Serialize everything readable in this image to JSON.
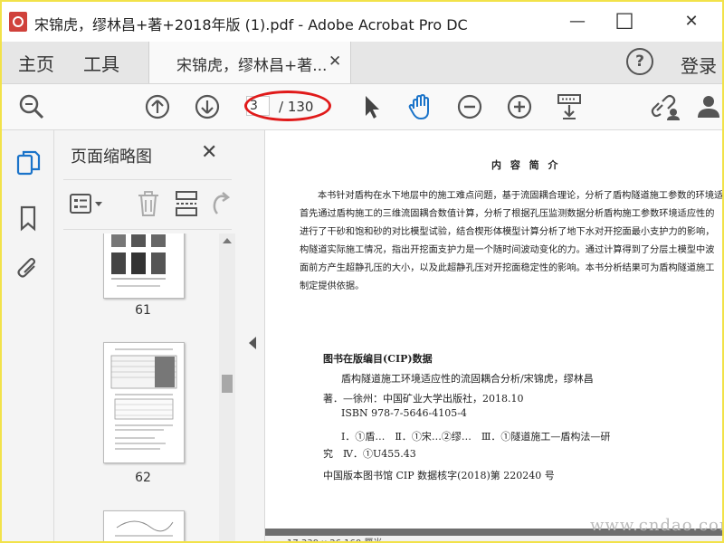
{
  "window": {
    "title": "宋锦虎，缪林昌+著+2018年版 (1).pdf - Adobe Acrobat Pro DC",
    "minimize": "—",
    "maximize": "☐",
    "close": "✕"
  },
  "tabs": {
    "home": "主页",
    "tools": "工具",
    "document": "宋锦虎，缪林昌+著...",
    "document_close": "✕",
    "help": "?",
    "login": "登录"
  },
  "toolbar": {
    "current_page": "3",
    "total_pages": "/ 130"
  },
  "thumbnail_panel": {
    "title": "页面缩略图",
    "close": "✕",
    "thumbnails": [
      {
        "label": "61"
      },
      {
        "label": "62"
      }
    ]
  },
  "document": {
    "heading": "内 容 简 介",
    "abstract_lines": [
      "本书针对盾构在水下地层中的施工难点问题，基于流固耦合理论，分析了盾构隧道施工参数的环境适",
      "首先通过盾构施工的三维流固耦合数值计算，分析了根据孔压监测数据分析盾构施工参数环境适应性的",
      "进行了干砂和饱和砂的对比模型试验，结合楔形体模型计算分析了地下水对开挖面最小支护力的影响，",
      "构隧道实际施工情况，指出开挖面支护力是一个随时间波动变化的力。通过计算得到了分层土模型中波",
      "面前方产生超静孔压的大小，以及此超静孔压对开挖面稳定性的影响。本书分析结果可为盾构隧道施工",
      "制定提供依据。"
    ],
    "cip_title": "图书在版编目(CIP)数据",
    "cip_lines": [
      "盾构隧道施工环境适应性的流固耦合分析/宋锦虎，缪林昌",
      "著．—徐州：中国矿业大学出版社，2018.10",
      "ISBN 978-7-5646-4105-4",
      "Ⅰ．①盾…　Ⅱ．①宋…②缪…　Ⅲ．①隧道施工—盾构法—研",
      "究　Ⅳ．①U455.43",
      "中国版本图书馆 CIP 数据核字(2018)第 220240 号"
    ]
  },
  "statusbar": {
    "dimensions": "17.330 x 26.160 厘米"
  },
  "watermark": "www.cndao.com",
  "colors": {
    "accent_blue": "#1a73c9",
    "annotation_red": "#e01a1a",
    "frame_yellow": "#f2e24a"
  }
}
